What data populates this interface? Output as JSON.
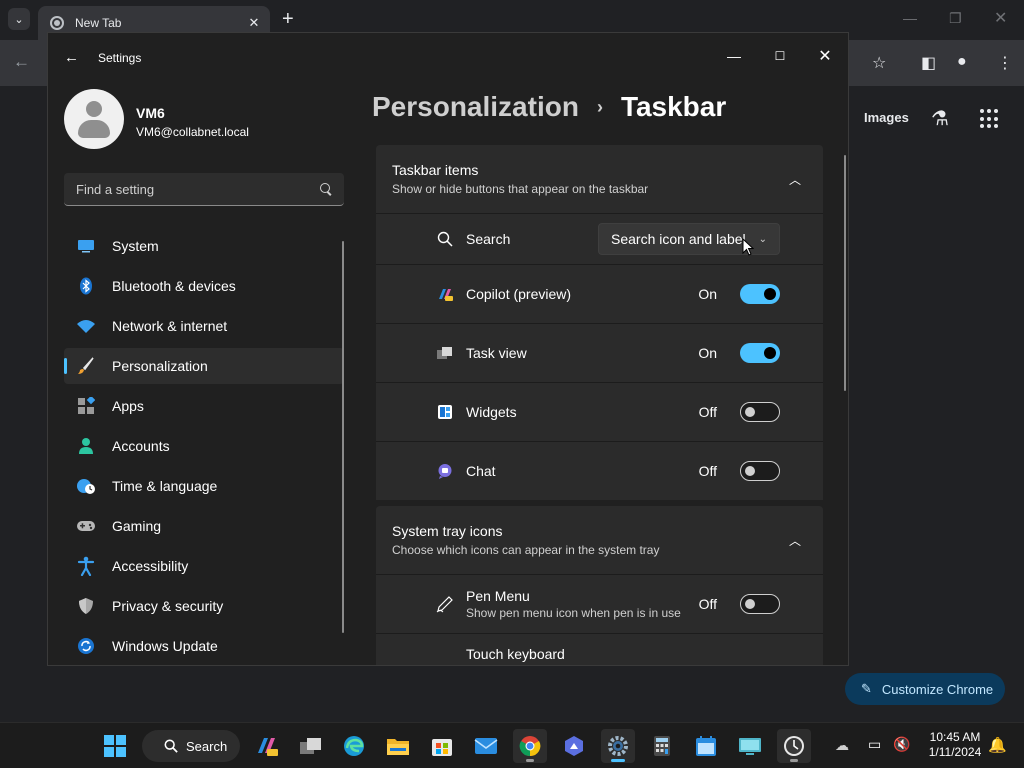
{
  "chrome": {
    "tab_title": "New Tab",
    "new_tab_label": "+",
    "images_link": "Images",
    "customize_label": "Customize Chrome"
  },
  "settings": {
    "window_title": "Settings",
    "profile": {
      "name": "VM6",
      "email": "VM6@collabnet.local"
    },
    "search": {
      "placeholder": "Find a setting"
    },
    "nav": [
      {
        "label": "System",
        "icon": "system-icon"
      },
      {
        "label": "Bluetooth & devices",
        "icon": "bluetooth-icon"
      },
      {
        "label": "Network & internet",
        "icon": "wifi-icon"
      },
      {
        "label": "Personalization",
        "icon": "brush-icon",
        "selected": true
      },
      {
        "label": "Apps",
        "icon": "apps-icon"
      },
      {
        "label": "Accounts",
        "icon": "accounts-icon"
      },
      {
        "label": "Time & language",
        "icon": "globe-clock-icon"
      },
      {
        "label": "Gaming",
        "icon": "gamepad-icon"
      },
      {
        "label": "Accessibility",
        "icon": "accessibility-icon"
      },
      {
        "label": "Privacy & security",
        "icon": "shield-icon"
      },
      {
        "label": "Windows Update",
        "icon": "update-icon"
      }
    ],
    "breadcrumb": {
      "parent": "Personalization",
      "separator": "›",
      "current": "Taskbar"
    },
    "taskbar_items": {
      "title": "Taskbar items",
      "description": "Show or hide buttons that appear on the taskbar",
      "search": {
        "label": "Search",
        "dropdown_value": "Search icon and label"
      },
      "toggles": [
        {
          "label": "Copilot (preview)",
          "state": "On",
          "on": true,
          "icon": "copilot-icon"
        },
        {
          "label": "Task view",
          "state": "On",
          "on": true,
          "icon": "task-view-icon"
        },
        {
          "label": "Widgets",
          "state": "Off",
          "on": false,
          "icon": "widgets-icon"
        },
        {
          "label": "Chat",
          "state": "Off",
          "on": false,
          "icon": "chat-icon"
        }
      ]
    },
    "system_tray": {
      "title": "System tray icons",
      "description": "Choose which icons can appear in the system tray",
      "pen_menu": {
        "label": "Pen Menu",
        "sublabel": "Show pen menu icon when pen is in use",
        "state": "Off"
      },
      "touch_keyboard": {
        "label": "Touch keyboard"
      }
    }
  },
  "taskbar": {
    "search_label": "Search",
    "time": "10:45 AM",
    "date": "1/11/2024"
  },
  "colors": {
    "accent": "#4cc2ff",
    "panel": "#2b2b2b",
    "window_bg": "#202020"
  }
}
